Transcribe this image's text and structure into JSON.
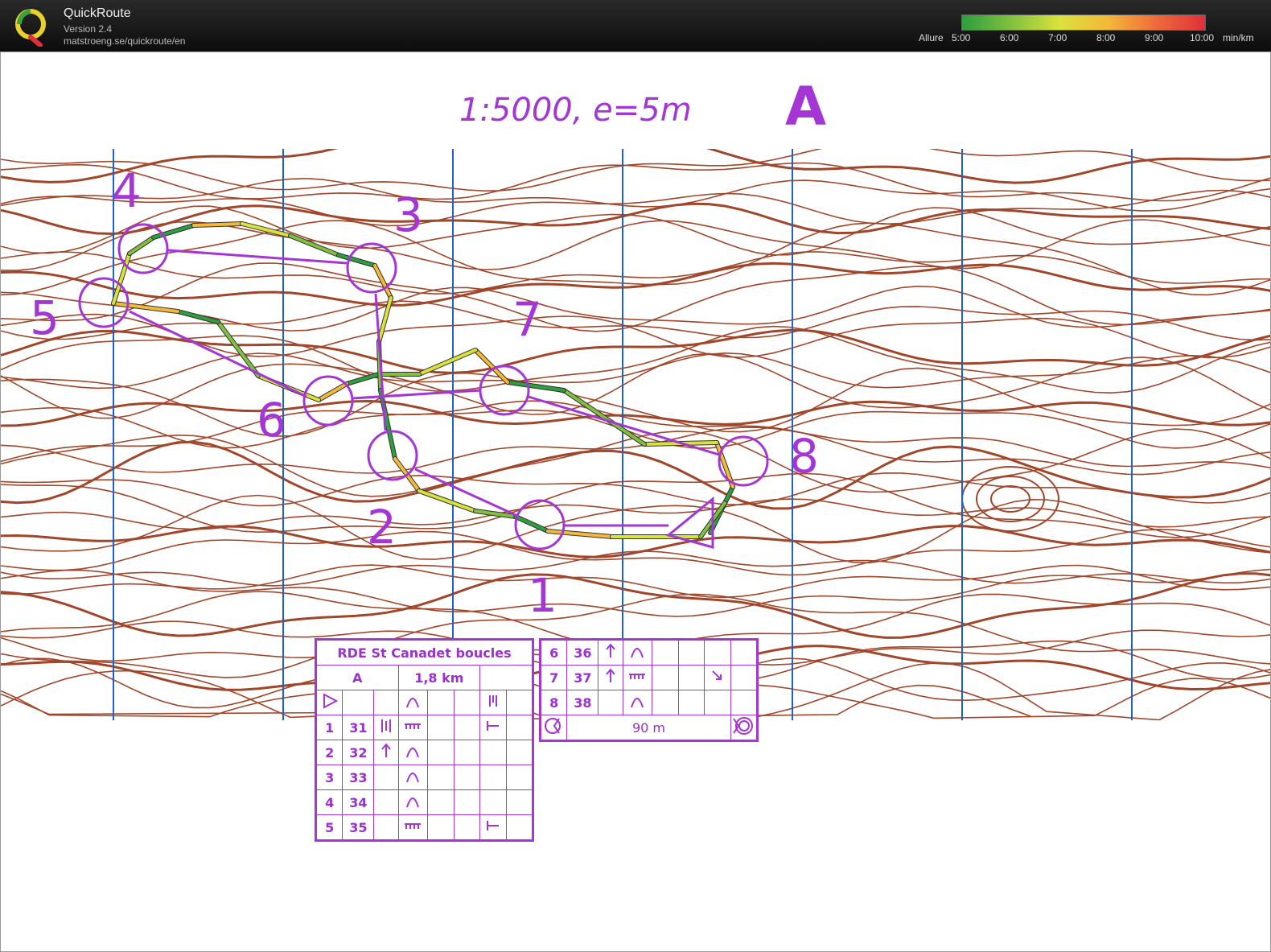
{
  "app": {
    "title": "QuickRoute",
    "version": "Version 2.4",
    "url": "matstroeng.se/quickroute/en"
  },
  "pace_scale": {
    "label": "Allure",
    "ticks": [
      "5:00",
      "6:00",
      "7:00",
      "8:00",
      "9:00",
      "10:00"
    ],
    "unit": "min/km",
    "colors": [
      "#2e9e3e",
      "#7fc03f",
      "#d9e23c",
      "#f3b93a",
      "#ee6a3b",
      "#e0303a"
    ]
  },
  "map": {
    "scale_text": "1:5000,  e=5m",
    "course_letter": "A",
    "control_numbers": [
      "1",
      "2",
      "3",
      "4",
      "5",
      "6",
      "7",
      "8"
    ],
    "colors": {
      "contour": "#a0462a",
      "overprint": "#a436d6",
      "north_lines": "#1f62c3"
    }
  },
  "description_sheet": {
    "event": "RDE St Canadet boucles",
    "course": "A",
    "length": "1,8 km",
    "rows": [
      {
        "num": "1",
        "code": "31"
      },
      {
        "num": "2",
        "code": "32"
      },
      {
        "num": "3",
        "code": "33"
      },
      {
        "num": "4",
        "code": "34"
      },
      {
        "num": "5",
        "code": "35"
      }
    ],
    "rows2": [
      {
        "num": "6",
        "code": "36"
      },
      {
        "num": "7",
        "code": "37"
      },
      {
        "num": "8",
        "code": "38"
      }
    ],
    "finish_distance": "90 m"
  }
}
